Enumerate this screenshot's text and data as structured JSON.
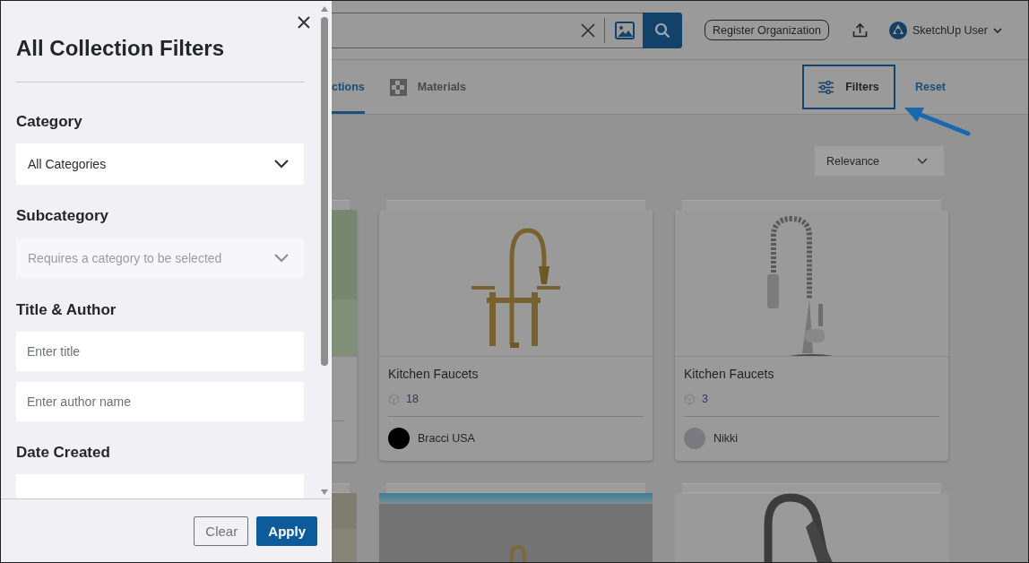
{
  "filter_panel": {
    "title": "All Collection Filters",
    "sections": [
      {
        "label": "Category",
        "kind": "select",
        "value": "All Categories",
        "disabled": false
      },
      {
        "label": "Subcategory",
        "kind": "select",
        "placeholder": "Requires a category to be selected",
        "disabled": true
      },
      {
        "label": "Title & Author",
        "kind": "text",
        "fields": [
          {
            "placeholder": "Enter title"
          },
          {
            "placeholder": "Enter author name"
          }
        ]
      },
      {
        "label": "Date Created",
        "kind": "date"
      }
    ],
    "buttons": [
      {
        "label": "Clear",
        "kind": "secondary"
      },
      {
        "label": "Apply",
        "kind": "primary"
      }
    ]
  },
  "header": {
    "register_button": "Register Organization",
    "user_name": "SketchUp User"
  },
  "tabs": [
    {
      "label": "ctions",
      "selected": true
    },
    {
      "label": "Materials",
      "selected": false
    }
  ],
  "filters_button": "Filters",
  "reset_link": "Reset",
  "sort": {
    "value": "Relevance"
  },
  "cards": [
    {
      "title": "Kitchen Faucets",
      "count": "18",
      "author": "Bracci USA"
    },
    {
      "title": "Kitchen Faucets",
      "count": "3",
      "author": "Nikki"
    }
  ]
}
